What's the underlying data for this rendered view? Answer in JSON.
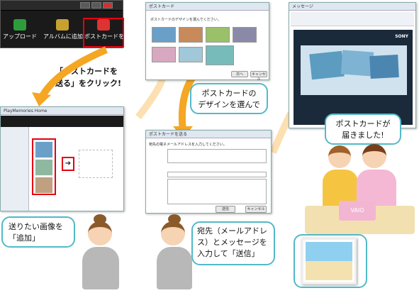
{
  "toolbar": {
    "items": [
      {
        "label": "アップロード",
        "color": "#2e9c3c"
      },
      {
        "label": "アルバムに追加",
        "color": "#c8a032"
      },
      {
        "label": "ポストカードを送る",
        "color": "#d33"
      }
    ]
  },
  "callouts": {
    "click_postcard": "「ポストカードを\n送る」をクリック!",
    "choose_design": "ポストカードの\nデザインを選んで",
    "arrived": "ポストカードが\n届きました!",
    "add_image": "送りたい画像を\n「追加」",
    "enter_send": "宛先（メールアドレ\nス）とメッセージを\n入力して「送信」"
  },
  "colors": {
    "highlight": "#e60012",
    "callout_border": "#52b9c8",
    "arrow": "#f5a623",
    "email_bg": "#1b2a3a"
  },
  "screens": {
    "design_title": "ポストカードのデザインを選んでください。",
    "address_hint": "宛先の電子メールアドレスを入力してください。",
    "email_brand": "SONY"
  }
}
